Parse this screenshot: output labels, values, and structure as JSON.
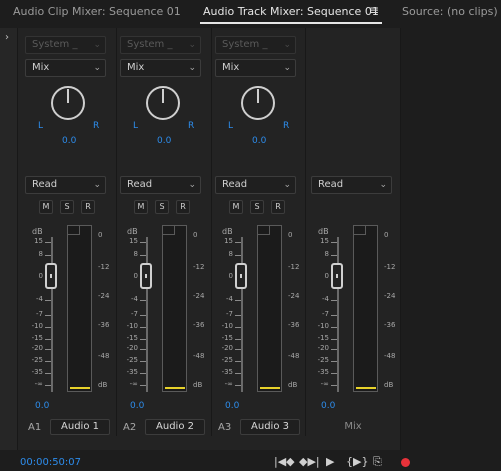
{
  "tabs": [
    {
      "label": "Audio Clip Mixer: Sequence 01"
    },
    {
      "label": "Audio Track Mixer: Sequence 01"
    },
    {
      "label": "Source: (no clips)"
    }
  ],
  "tab_menu_icon": "hamburger-icon",
  "collapse_icon": "chevron-right-icon",
  "strips": [
    {
      "input": "System _",
      "mode": "Mix",
      "pan_l": "L",
      "pan_r": "R",
      "pan_value": "0.0",
      "automation": "Read",
      "m": "M",
      "s": "S",
      "r": "R",
      "fader_value": "0.0",
      "track_id": "A1",
      "track_name": "Audio 1",
      "meter_level": "yellow"
    },
    {
      "input": "System _",
      "mode": "Mix",
      "pan_l": "L",
      "pan_r": "R",
      "pan_value": "0.0",
      "automation": "Read",
      "m": "M",
      "s": "S",
      "r": "R",
      "fader_value": "0.0",
      "track_id": "A2",
      "track_name": "Audio 2",
      "meter_level": "yellow"
    },
    {
      "input": "System _",
      "mode": "Mix",
      "pan_l": "L",
      "pan_r": "R",
      "pan_value": "0.0",
      "automation": "Read",
      "m": "M",
      "s": "S",
      "r": "R",
      "fader_value": "0.0",
      "track_id": "A3",
      "track_name": "Audio 3",
      "meter_level": "yellow"
    }
  ],
  "master": {
    "automation": "Read",
    "fader_value": "0.0",
    "track_name": "Mix"
  },
  "fader_scale": [
    "dB",
    "15",
    "8",
    "0",
    "-4",
    "-7",
    "-10",
    "-15",
    "-20",
    "-25",
    "-35",
    "-∞"
  ],
  "meter_scale": [
    "0",
    "-12",
    "-24",
    "-36",
    "-48",
    "dB"
  ],
  "colors": {
    "accent": "#2d8ceb",
    "meter_peak": "#e7d22a",
    "record": "#e8323a"
  },
  "bottom": {
    "timecode": "00:00:50:07",
    "buttons": [
      "go-to-in-icon",
      "go-to-out-icon",
      "play-icon",
      "loop-icon",
      "loop-playback-icon",
      "record-icon"
    ]
  }
}
